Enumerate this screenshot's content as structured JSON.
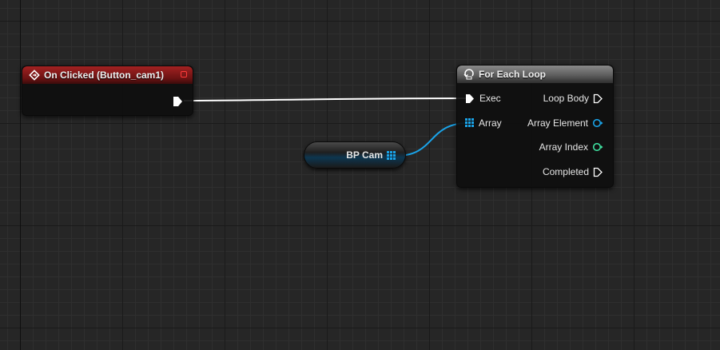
{
  "colors": {
    "exec_pin": "#ffffff",
    "array_pin": "#1aa3e8",
    "array_element_pin": "#1aa3e8",
    "array_index_pin": "#3fe0a0",
    "event_header": "#a32222",
    "loop_header": "#707070",
    "delegate": "#ff3b3b"
  },
  "event_node": {
    "title": "On Clicked (Button_cam1)",
    "icon": "event-diamond-icon",
    "delegate_icon": "delegate-square-icon"
  },
  "loop_node": {
    "title": "For Each Loop",
    "icon": "loop-macro-icon",
    "inputs": [
      {
        "label": "Exec",
        "type": "exec"
      },
      {
        "label": "Array",
        "type": "array"
      }
    ],
    "outputs": [
      {
        "label": "Loop Body",
        "type": "exec"
      },
      {
        "label": "Array Element",
        "type": "object"
      },
      {
        "label": "Array Index",
        "type": "integer"
      },
      {
        "label": "Completed",
        "type": "exec"
      }
    ]
  },
  "variable_node": {
    "label": "BP Cam",
    "icon": "array-grid-icon"
  }
}
